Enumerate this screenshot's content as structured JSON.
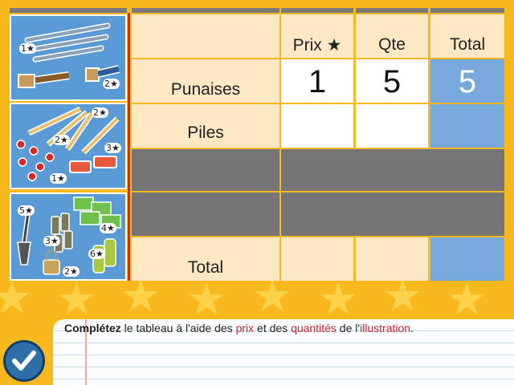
{
  "table": {
    "headers": {
      "prix": "Prix ★",
      "qte": "Qte",
      "total": "Total"
    },
    "rows": [
      {
        "label": "Punaises",
        "prix": "1",
        "qte": "5",
        "total": "5"
      },
      {
        "label": "Piles",
        "prix": "",
        "qte": "",
        "total": ""
      },
      {
        "label": "",
        "prix": "",
        "qte": "",
        "total": ""
      },
      {
        "label": "",
        "prix": "",
        "qte": "",
        "total": ""
      },
      {
        "label": "Total",
        "prix": "",
        "qte": "",
        "total": ""
      }
    ]
  },
  "illustration": {
    "prices": [
      "1★",
      "2★",
      "2★",
      "3★",
      "1★",
      "5★",
      "4★",
      "3★",
      "2★",
      "6★"
    ],
    "items": [
      "crayons-icon",
      "pinceaux-icon",
      "crayons-de-couleur-icon",
      "punaises-icon",
      "gommes-icon",
      "pelle-icon",
      "enveloppes-icon",
      "piles-icon",
      "cadenas-icon",
      "vaporisateurs-icon"
    ]
  },
  "instruction": {
    "p1": "Complétez",
    "p2": " le tableau à l'aide des ",
    "p3": "prix",
    "p4": " et des ",
    "p5": "quantités",
    "p6": " de l'",
    "p7": "illustration",
    "p8": "."
  },
  "colors": {
    "blue": "#5b9bd5",
    "cream": "#fde8c6",
    "orange": "#f9b81c",
    "gray": "#757575",
    "red": "#d0202a"
  },
  "validate_icon": "check-icon"
}
